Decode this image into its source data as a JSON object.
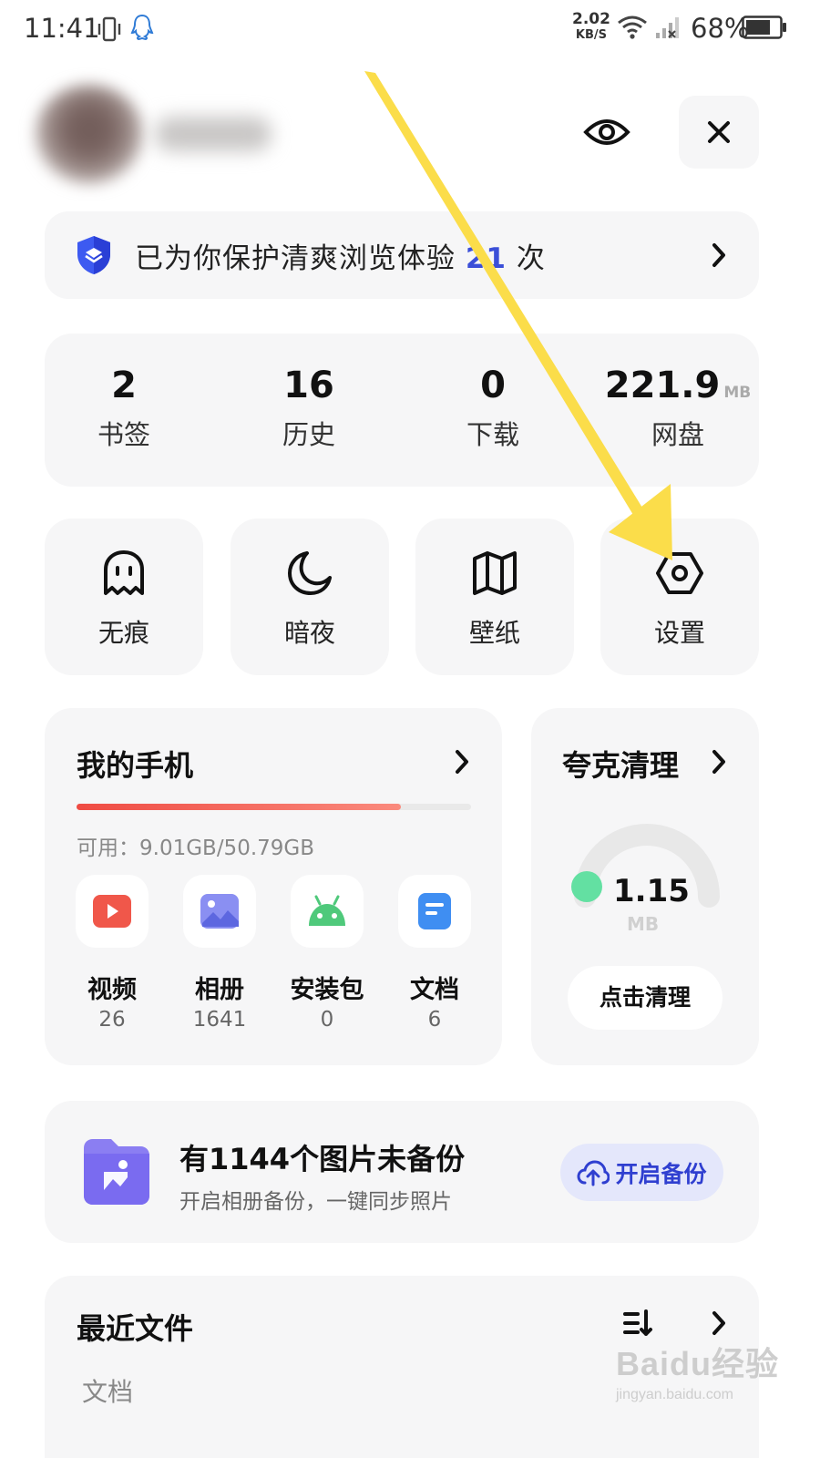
{
  "status_bar": {
    "time": "11:41",
    "net_speed_value": "2.02",
    "net_speed_unit": "KB/S",
    "battery_percent": "68%"
  },
  "protection": {
    "text_before": "已为你保护清爽浏览体验 ",
    "count": "21",
    "text_after": " 次"
  },
  "stats": [
    {
      "value": "2",
      "unit": "",
      "label": "书签"
    },
    {
      "value": "16",
      "unit": "",
      "label": "历史"
    },
    {
      "value": "0",
      "unit": "",
      "label": "下载"
    },
    {
      "value": "221.9",
      "unit": "MB",
      "label": "网盘"
    }
  ],
  "tools": [
    {
      "label": "无痕",
      "icon": "ghost-icon"
    },
    {
      "label": "暗夜",
      "icon": "moon-icon"
    },
    {
      "label": "壁纸",
      "icon": "book-icon"
    },
    {
      "label": "设置",
      "icon": "hexagon-settings-icon"
    }
  ],
  "my_phone": {
    "title": "我的手机",
    "available_label": "可用：9.01GB/50.79GB",
    "used_fraction": 0.823,
    "file_types": [
      {
        "label": "视频",
        "count": "26",
        "icon": "video-icon",
        "color": "#f0574a"
      },
      {
        "label": "相册",
        "count": "1641",
        "icon": "album-icon",
        "color": "#7e86f0"
      },
      {
        "label": "安装包",
        "count": "0",
        "icon": "android-icon",
        "color": "#4fc97b"
      },
      {
        "label": "文档",
        "count": "6",
        "icon": "document-icon",
        "color": "#3f8ef2"
      }
    ]
  },
  "cleaner": {
    "title": "夸克清理",
    "size_value": "1.15",
    "size_unit": "MB",
    "button_label": "点击清理"
  },
  "backup": {
    "title": "有1144个图片未备份",
    "subtitle": "开启相册备份，一键同步照片",
    "button_label": "开启备份"
  },
  "recent_files": {
    "title": "最近文件",
    "tab": "文档"
  },
  "watermark": {
    "main": "Baidu经验",
    "sub": "jingyan.baidu.com"
  },
  "colors": {
    "accent_blue": "#3b4fd8",
    "arrow_yellow": "#fbdd4a",
    "card_bg": "#f6f6f7"
  }
}
